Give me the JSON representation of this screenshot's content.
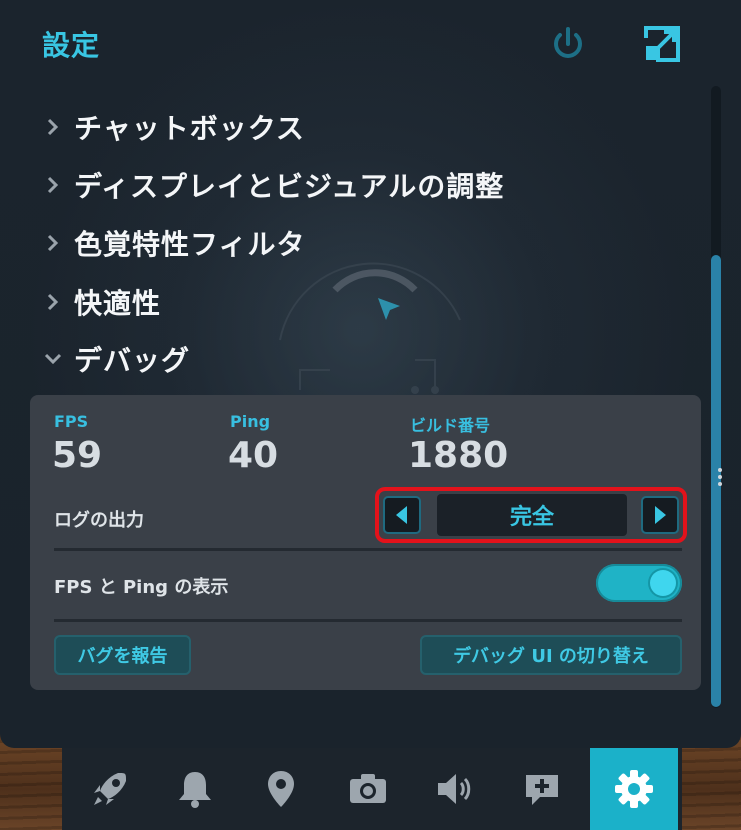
{
  "header": {
    "title": "設定",
    "power_icon": "power-icon",
    "expand_icon": "expand-icon"
  },
  "menu": {
    "items": [
      {
        "label": "チャットボックス",
        "expanded": false
      },
      {
        "label": "ディスプレイとビジュアルの調整",
        "expanded": false
      },
      {
        "label": "色覚特性フィルタ",
        "expanded": false
      },
      {
        "label": "快適性",
        "expanded": false
      },
      {
        "label": "デバッグ",
        "expanded": true
      }
    ]
  },
  "debug": {
    "fps_label": "FPS",
    "fps_value": "59",
    "ping_label": "Ping",
    "ping_value": "40",
    "build_label": "ビルド番号",
    "build_value": "1880",
    "log_label": "ログの出力",
    "log_value": "完全",
    "show_label": "FPS と Ping の表示",
    "show_enabled": true,
    "report_button": "バグを報告",
    "toggle_ui_button": "デバッグ UI の切り替え"
  },
  "bottom_tabs": [
    {
      "icon": "rocket-icon",
      "active": false
    },
    {
      "icon": "bell-icon",
      "active": false
    },
    {
      "icon": "location-pin-icon",
      "active": false
    },
    {
      "icon": "camera-icon",
      "active": false
    },
    {
      "icon": "speaker-icon",
      "active": false
    },
    {
      "icon": "chat-add-icon",
      "active": false
    },
    {
      "icon": "gear-icon",
      "active": true
    }
  ],
  "colors": {
    "accent": "#39c6e3",
    "panel": "#1b242d",
    "card": "#3a4048",
    "highlight": "#e3121b",
    "active_tab": "#1bb1c9"
  }
}
